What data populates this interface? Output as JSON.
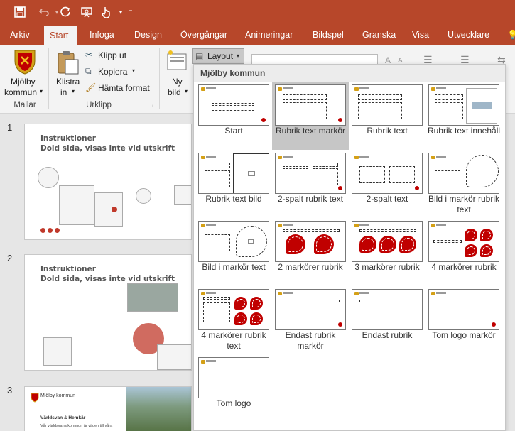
{
  "colors": {
    "accent": "#b7472a",
    "marker_red": "#c00000"
  },
  "qat": [
    {
      "icon": "save-icon",
      "glyph": "💾"
    },
    {
      "icon": "undo-icon",
      "glyph": "↶"
    },
    {
      "icon": "redo-icon",
      "glyph": "↻"
    },
    {
      "icon": "present-icon",
      "glyph": "▣"
    },
    {
      "icon": "touch-icon",
      "glyph": "☝"
    },
    {
      "icon": "customize-icon",
      "glyph": "▾"
    }
  ],
  "tabs": [
    "Arkiv",
    "Start",
    "Infoga",
    "Design",
    "Övergångar",
    "Animeringar",
    "Bildspel",
    "Granska",
    "Visa",
    "Utvecklare"
  ],
  "active_tab": "Start",
  "ribbon": {
    "mallar": {
      "button_line1": "Mjölby",
      "button_line2": "kommun",
      "group": "Mallar"
    },
    "urklipp": {
      "paste_line1": "Klistra",
      "paste_line2": "in",
      "cut": "Klipp ut",
      "copy": "Kopiera",
      "format_painter": "Hämta format",
      "group": "Urklipp"
    },
    "slides": {
      "new_line1": "Ny",
      "new_line2": "bild",
      "layout": "Layout"
    }
  },
  "slides": [
    {
      "number": "1",
      "title1": "Instruktioner",
      "title2": "Dold sida, visas inte vid utskrift"
    },
    {
      "number": "2",
      "title1": "Instruktioner",
      "title2": "Dold sida, visas inte vid utskrift"
    },
    {
      "number": "3",
      "logo_text": "Mjölby kommun",
      "title1": "Världsvan & Hemkär",
      "body": "Vår världsvana kommun är vägen till våra"
    }
  ],
  "layout_panel": {
    "header": "Mjölby kommun",
    "selected": "Rubrik text markör",
    "items": [
      {
        "name": "start",
        "label": "Start",
        "kind": "start"
      },
      {
        "name": "rubrik-text-markor",
        "label": "Rubrik text markör",
        "kind": "rtm"
      },
      {
        "name": "rubrik-text",
        "label": "Rubrik text",
        "kind": "rt"
      },
      {
        "name": "rubrik-text-innehall",
        "label": "Rubrik text innehåll",
        "kind": "rti"
      },
      {
        "name": "rubrik-text-bild",
        "label": "Rubrik text bild",
        "kind": "rtb"
      },
      {
        "name": "2-spalt-rubrik-text",
        "label": "2-spalt rubrik text",
        "kind": "2srt"
      },
      {
        "name": "2-spalt-text",
        "label": "2-spalt text",
        "kind": "2st"
      },
      {
        "name": "bild-i-markor-rubrik-text",
        "label": "Bild i markör rubrik text",
        "kind": "bmrt"
      },
      {
        "name": "bild-i-markor-text",
        "label": "Bild i markör text",
        "kind": "bmt"
      },
      {
        "name": "2-markorer-rubrik",
        "label": "2 markörer rubrik",
        "kind": "m2"
      },
      {
        "name": "3-markorer-rubrik",
        "label": "3 markörer rubrik",
        "kind": "m3"
      },
      {
        "name": "4-markorer-rubrik",
        "label": "4 markörer rubrik",
        "kind": "m4"
      },
      {
        "name": "4-markorer-rubrik-text",
        "label": "4 markörer rubrik text",
        "kind": "m4t"
      },
      {
        "name": "endast-rubrik-markor",
        "label": "Endast rubrik markör",
        "kind": "erm"
      },
      {
        "name": "endast-rubrik",
        "label": "Endast rubrik",
        "kind": "er"
      },
      {
        "name": "tom-logo-markor",
        "label": "Tom logo markör",
        "kind": "tlm"
      },
      {
        "name": "tom-logo",
        "label": "Tom logo",
        "kind": "tl"
      }
    ]
  }
}
